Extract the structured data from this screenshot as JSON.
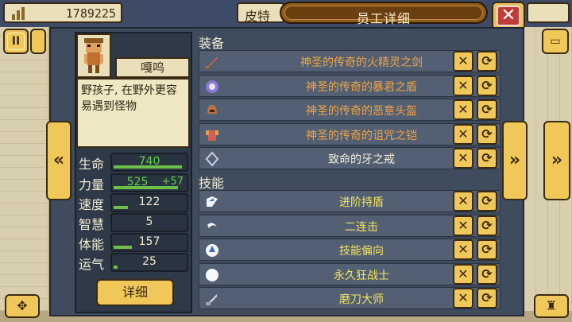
{
  "topbar": {
    "money": "1789225",
    "name_partial": "皮特",
    "title": "员工详细",
    "close_glyph": "✕"
  },
  "character": {
    "name": "嘎呜",
    "description": "野孩子, 在野外更容易遇到怪物",
    "stats": [
      {
        "label": "生命",
        "value": "740",
        "bonus": "",
        "fill": 0.95
      },
      {
        "label": "力量",
        "value": "525",
        "bonus": "+57",
        "fill": 0.9
      },
      {
        "label": "速度",
        "value": "122",
        "bonus": "",
        "fill": 0.2
      },
      {
        "label": "智慧",
        "value": "5",
        "bonus": "",
        "fill": 0.0
      },
      {
        "label": "体能",
        "value": "157",
        "bonus": "",
        "fill": 0.25
      },
      {
        "label": "运气",
        "value": "25",
        "bonus": "",
        "fill": 0.05
      }
    ],
    "detail_button": "详细"
  },
  "equipment": {
    "title": "装备",
    "items": [
      {
        "name": "神圣的传奇的火精灵之剑",
        "icon": "sword-icon",
        "color": "#f2a340"
      },
      {
        "name": "神圣的传奇的暴君之盾",
        "icon": "shield-icon",
        "color": "#f2a340"
      },
      {
        "name": "神圣的传奇的恶意头盔",
        "icon": "helmet-icon",
        "color": "#f2a340"
      },
      {
        "name": "神圣的传奇的诅咒之铠",
        "icon": "armor-icon",
        "color": "#f2a340"
      },
      {
        "name": "致命的牙之戒",
        "icon": "ring-icon",
        "color": "#f4ecd4"
      }
    ]
  },
  "skills": {
    "title": "技能",
    "items": [
      {
        "name": "进阶持盾",
        "icon": "shield-skill-icon"
      },
      {
        "name": "二连击",
        "icon": "slash-icon"
      },
      {
        "name": "技能偏向",
        "icon": "globe-icon"
      },
      {
        "name": "永久狂战士",
        "icon": "circle-icon"
      },
      {
        "name": "磨刀大师",
        "icon": "whetstone-icon"
      }
    ]
  },
  "buttons": {
    "remove_glyph": "✕",
    "swap_glyph": "⟳",
    "prev_glyph": "«",
    "next_glyph": "»"
  }
}
